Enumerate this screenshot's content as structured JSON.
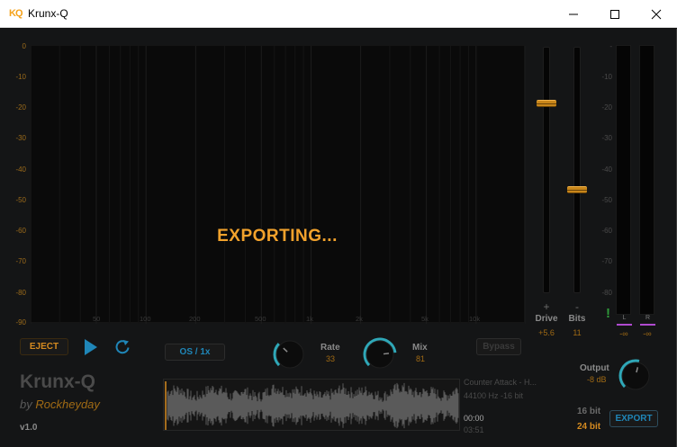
{
  "window": {
    "logo_text": "KQ",
    "title": "Krunx-Q"
  },
  "spectrum": {
    "db_labels": [
      "0",
      "-10",
      "-20",
      "-30",
      "-40",
      "-50",
      "-60",
      "-70",
      "-80",
      "-90"
    ],
    "freq_labels": [
      "50",
      "100",
      "200",
      "500",
      "1k",
      "2k",
      "5k",
      "10k"
    ],
    "status_text": "EXPORTING..."
  },
  "drive": {
    "sign": "+",
    "label": "Drive",
    "value": "+5.6",
    "level": 0.23
  },
  "bits": {
    "sign": "-",
    "label": "Bits",
    "value": "11",
    "level": 0.58
  },
  "meters": {
    "db_labels": [
      "-",
      "-10",
      "-20",
      "-30",
      "-40",
      "-50",
      "-60",
      "-70",
      "-80"
    ],
    "clip_indicator": "!",
    "left": {
      "label": "L",
      "value": "-∞"
    },
    "right": {
      "label": "R",
      "value": "-∞"
    }
  },
  "transport": {
    "eject_label": "EJECT",
    "os_label": "OS / 1x",
    "bypass_label": "Bypass"
  },
  "knobs": {
    "rate": {
      "label": "Rate",
      "value": "33",
      "level": 0.33
    },
    "mix": {
      "label": "Mix",
      "value": "81",
      "level": 0.81
    },
    "output": {
      "label": "Output",
      "value": "-8 dB",
      "level": 0.55
    }
  },
  "brand": {
    "name": "Krunx-Q",
    "by": "by",
    "author": "Rockheyday",
    "version": "v1.0"
  },
  "track": {
    "title": "Counter Attack - H...",
    "format": "44100 Hz -16 bit",
    "time_current": "00:00",
    "time_total": "03:51"
  },
  "export": {
    "bits_16": "16 bit",
    "bits_24": "24 bit",
    "button_label": "EXPORT"
  },
  "colors": {
    "accent_orange": "#f2a22c",
    "accent_blue": "#1f86b8",
    "knob_arc": "#2fa8b8",
    "meter_marker": "#b04ad0",
    "clip_green": "#2f9a3a"
  }
}
